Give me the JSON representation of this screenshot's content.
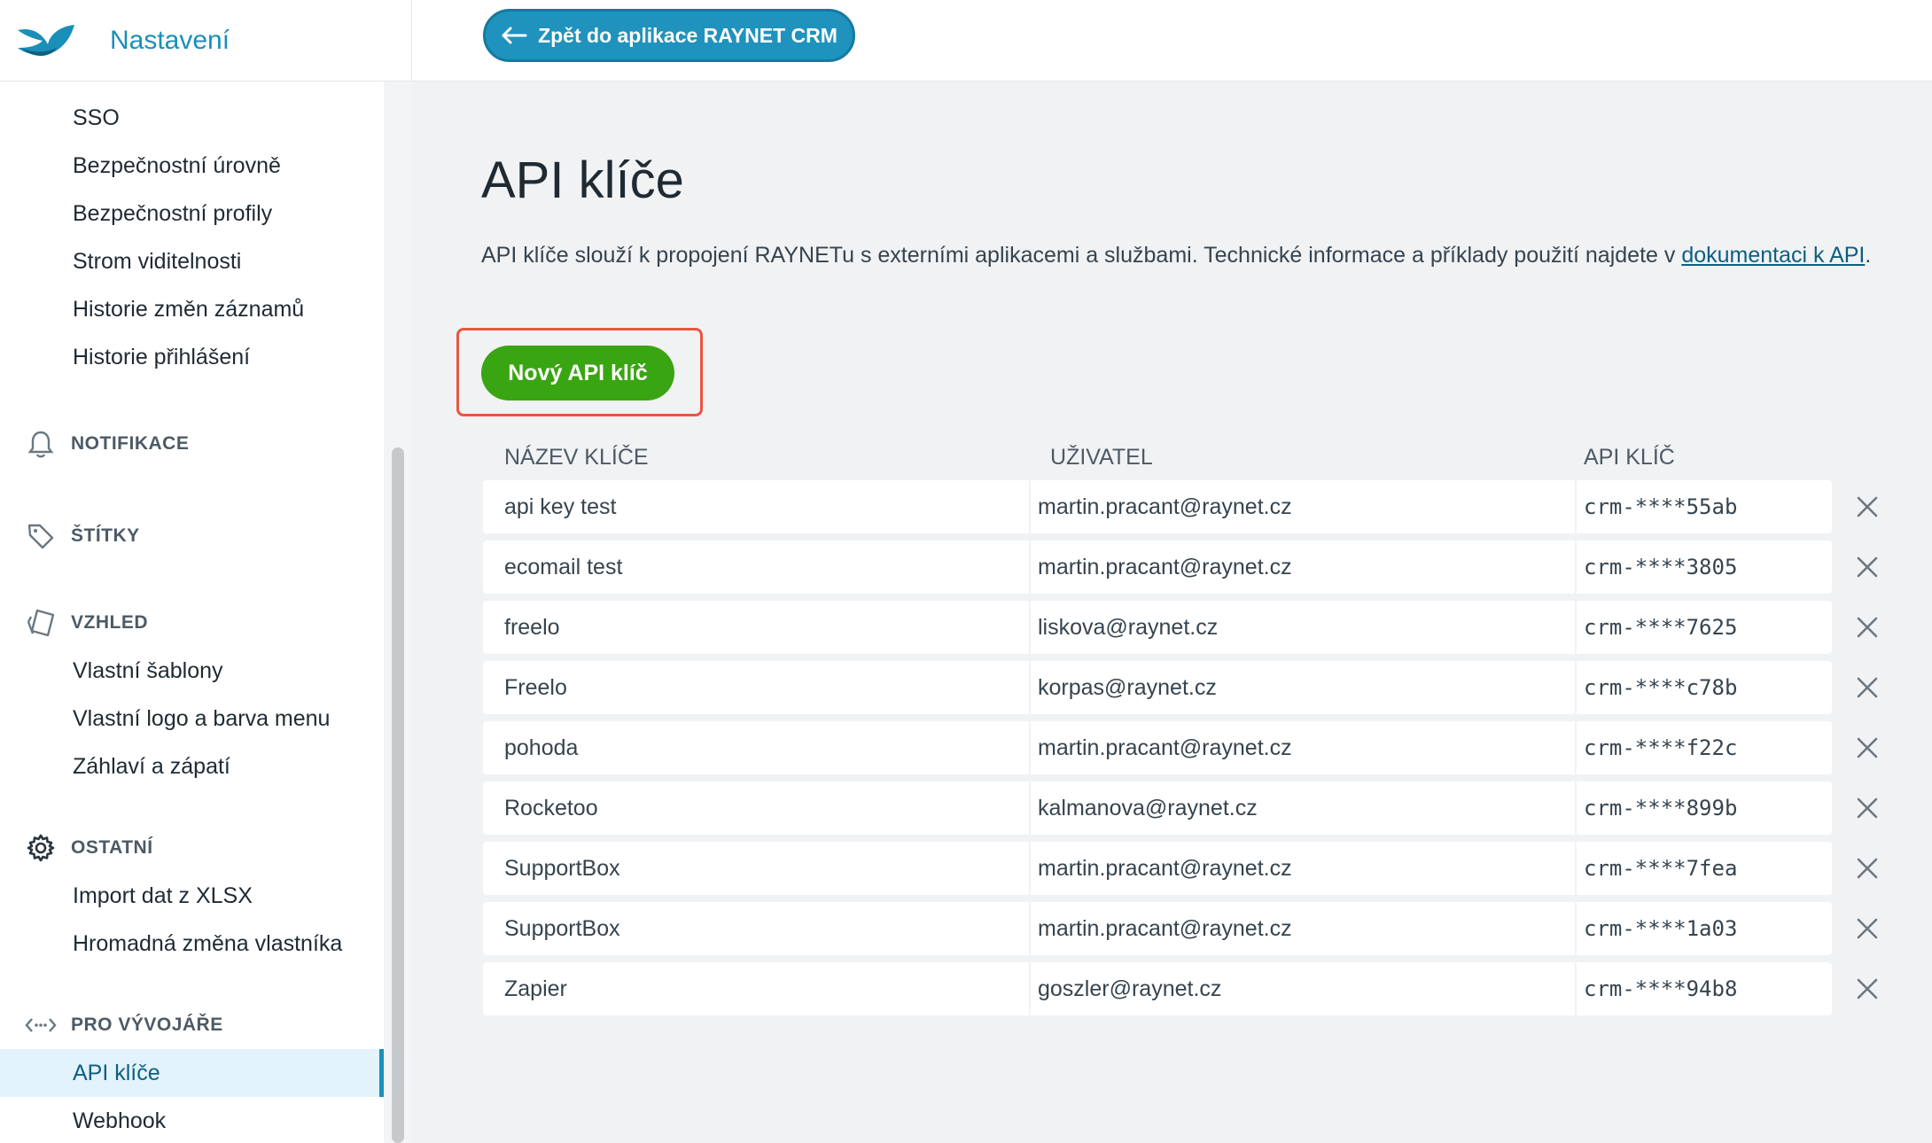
{
  "app": {
    "title": "Nastavení"
  },
  "topbar": {
    "back_label": "Zpět do aplikace RAYNET CRM"
  },
  "sidebar": {
    "items_top": [
      "SSO",
      "Bezpečnostní úrovně",
      "Bezpečnostní profily",
      "Strom viditelnosti",
      "Historie změn záznamů",
      "Historie přihlášení"
    ],
    "sections": {
      "notifikace": "NOTIFIKACE",
      "stitky": "ŠTÍTKY",
      "vzhled": "VZHLED",
      "ostatni": "OSTATNÍ",
      "vyvojari": "PRO VÝVOJÁŘE"
    },
    "vzhled_items": [
      "Vlastní šablony",
      "Vlastní logo a barva menu",
      "Záhlaví a zápatí"
    ],
    "ostatni_items": [
      "Import dat z XLSX",
      "Hromadná změna vlastníka"
    ],
    "vyvojari_items": [
      "API klíče",
      "Webhook"
    ],
    "active_item": "API klíče"
  },
  "main": {
    "title": "API klíče",
    "description": "API klíče slouží k propojení RAYNETu s externími aplikacemi a službami. Technické informace a příklady použití najdete v ",
    "doc_link": "dokumentaci k API",
    "description_end": ".",
    "new_key_label": "Nový API klíč",
    "columns": {
      "name": "NÁZEV KLÍČE",
      "user": "UŽIVATEL",
      "key": "API KLÍČ"
    },
    "rows": [
      {
        "name": "api key test",
        "user": "martin.pracant@raynet.cz",
        "key": "crm-****55ab"
      },
      {
        "name": "ecomail test",
        "user": "martin.pracant@raynet.cz",
        "key": "crm-****3805"
      },
      {
        "name": "freelo",
        "user": "liskova@raynet.cz",
        "key": "crm-****7625"
      },
      {
        "name": "Freelo",
        "user": "korpas@raynet.cz",
        "key": "crm-****c78b"
      },
      {
        "name": "pohoda",
        "user": "martin.pracant@raynet.cz",
        "key": "crm-****f22c"
      },
      {
        "name": "Rocketoo",
        "user": "kalmanova@raynet.cz",
        "key": "crm-****899b"
      },
      {
        "name": "SupportBox",
        "user": "martin.pracant@raynet.cz",
        "key": "crm-****7fea"
      },
      {
        "name": "SupportBox",
        "user": "martin.pracant@raynet.cz",
        "key": "crm-****1a03"
      },
      {
        "name": "Zapier",
        "user": "goszler@raynet.cz",
        "key": "crm-****94b8"
      }
    ]
  },
  "colors": {
    "brand": "#1a8fb8",
    "primary_green": "#3aa512",
    "highlight_frame": "#e8563f"
  },
  "icons": [
    "logo-icon",
    "arrow-left-icon",
    "bell-icon",
    "tag-icon",
    "palette-icon",
    "gear-icon",
    "code-icon",
    "close-icon"
  ]
}
